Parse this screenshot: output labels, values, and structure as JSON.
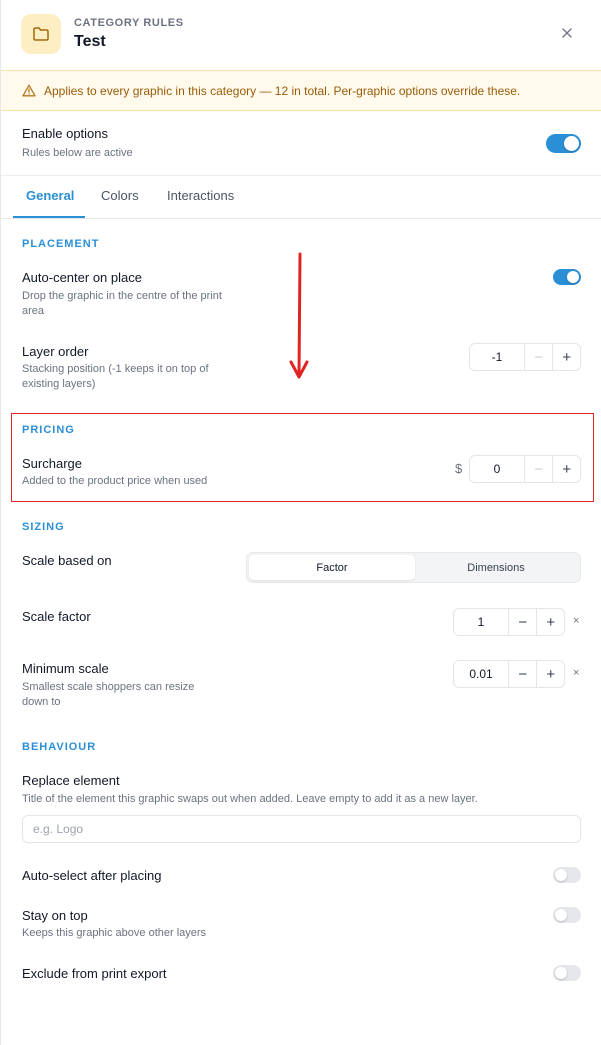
{
  "header": {
    "eyebrow": "CATEGORY RULES",
    "title": "Test",
    "icon": "folder-icon",
    "close_icon": "close-icon"
  },
  "banner": {
    "icon": "warning-icon",
    "text": "Applies to every graphic in this category — 12 in total. Per-graphic options override these."
  },
  "enable": {
    "label": "Enable options",
    "sub": "Rules below are active",
    "on": true
  },
  "tabs": [
    {
      "label": "General",
      "active": true
    },
    {
      "label": "Colors",
      "active": false
    },
    {
      "label": "Interactions",
      "active": false
    }
  ],
  "placement": {
    "heading": "PLACEMENT",
    "auto_center": {
      "label": "Auto-center on place",
      "sub": "Drop the graphic in the centre of the print area",
      "on": true
    },
    "layer_order": {
      "label": "Layer order",
      "sub": "Stacking position (-1 keeps it on top of existing layers)",
      "value": "-1",
      "minus": "−",
      "plus": "+"
    }
  },
  "pricing": {
    "heading": "PRICING",
    "surcharge": {
      "label": "Surcharge",
      "sub": "Added to the product price when used",
      "currency": "$",
      "value": "0",
      "minus": "−",
      "plus": "+"
    }
  },
  "sizing": {
    "heading": "SIZING",
    "scale_based_on": {
      "label": "Scale based on",
      "options": [
        "Factor",
        "Dimensions"
      ],
      "selected": "Factor"
    },
    "scale_factor": {
      "label": "Scale factor",
      "value": "1",
      "minus": "−",
      "plus": "+",
      "clear": "×"
    },
    "minimum_scale": {
      "label": "Minimum scale",
      "sub": "Smallest scale shoppers can resize down to",
      "value": "0.01",
      "minus": "−",
      "plus": "+",
      "clear": "×"
    }
  },
  "behaviour": {
    "heading": "BEHAVIOUR",
    "replace_element": {
      "label": "Replace element",
      "sub": "Title of the element this graphic swaps out when added. Leave empty to add it as a new layer.",
      "placeholder": "e.g. Logo",
      "value": ""
    },
    "auto_select": {
      "label": "Auto-select after placing",
      "on": false
    },
    "stay_on_top": {
      "label": "Stay on top",
      "sub": "Keeps this graphic above other layers",
      "on": false
    },
    "exclude_export": {
      "label": "Exclude from print export",
      "on": false
    }
  },
  "colors": {
    "accent": "#2b8fd6",
    "annotation": "#e02424",
    "banner_bg": "#fffaeb",
    "banner_text": "#9a5b0b"
  }
}
